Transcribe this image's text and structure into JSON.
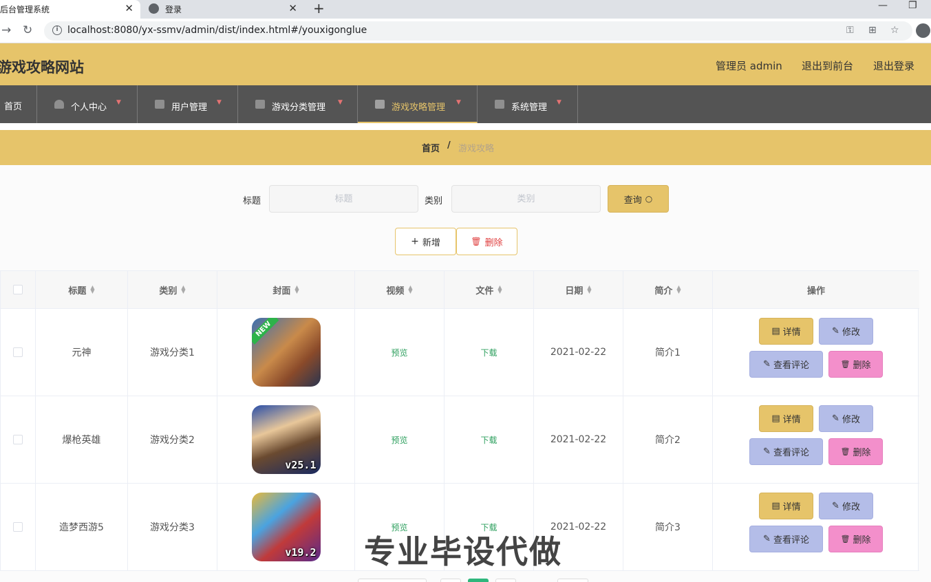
{
  "browser": {
    "tabs": [
      {
        "title": "后台管理系统",
        "active": true
      },
      {
        "title": "登录",
        "active": false
      }
    ],
    "url": "localhost:8080/yx-ssmv/admin/dist/index.html#/youxigonglue"
  },
  "header": {
    "site_title": "游戏攻略网站",
    "admin_label": "管理员 admin",
    "to_front": "退出到前台",
    "logout": "退出登录"
  },
  "nav": {
    "items": [
      {
        "label": "首页"
      },
      {
        "label": "个人中心"
      },
      {
        "label": "用户管理"
      },
      {
        "label": "游戏分类管理"
      },
      {
        "label": "游戏攻略管理"
      },
      {
        "label": "系统管理"
      }
    ]
  },
  "breadcrumb": {
    "home": "首页",
    "separator": "/",
    "current": "游戏攻略"
  },
  "search": {
    "title_label": "标题",
    "title_placeholder": "标题",
    "category_label": "类别",
    "category_placeholder": "类别",
    "query_button": "查询"
  },
  "actions": {
    "add": "新增",
    "delete": "删除"
  },
  "table": {
    "headers": [
      "标题",
      "类别",
      "封面",
      "视频",
      "文件",
      "日期",
      "简介",
      "操作"
    ],
    "rows": [
      {
        "title": "元神",
        "category": "游戏分类1",
        "video": "预览",
        "file": "下载",
        "date": "2021-02-22",
        "intro": "简介1",
        "cover_badge": "NEW"
      },
      {
        "title": "爆枪英雄",
        "category": "游戏分类2",
        "video": "预览",
        "file": "下载",
        "date": "2021-02-22",
        "intro": "简介2",
        "cover_badge": "v25.1"
      },
      {
        "title": "造梦西游5",
        "category": "游戏分类3",
        "video": "预览",
        "file": "下载",
        "date": "2021-02-22",
        "intro": "简介3",
        "cover_badge": "v19.2"
      }
    ],
    "row_actions": {
      "detail": "详情",
      "edit": "修改",
      "comments": "查看评论",
      "delete": "删除"
    }
  },
  "watermark": "专业毕设代做",
  "colors": {
    "accent": "#e6c46a",
    "nav_bg": "#545454",
    "edit": "#b4bde8",
    "delete": "#f38fcb",
    "link": "#2fa05f"
  }
}
